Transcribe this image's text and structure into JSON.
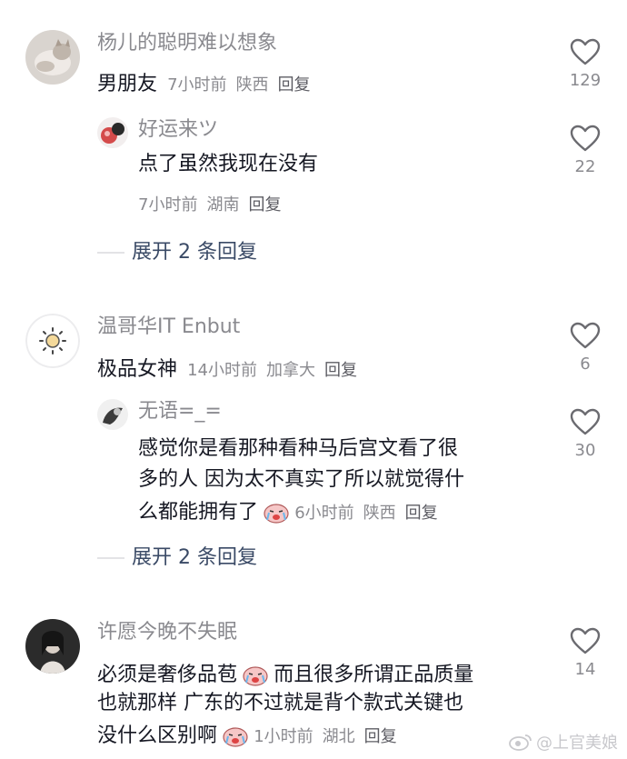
{
  "comments": [
    {
      "username": "杨儿的聪明难以想象",
      "text": "男朋友",
      "time": "7小时前",
      "location": "陕西",
      "reply_label": "回复",
      "likes": "129",
      "replies": [
        {
          "username": "好运来ツ",
          "text_lines": [
            "点了虽然我现在没有"
          ],
          "time": "7小时前",
          "location": "湖南",
          "reply_label": "回复",
          "likes": "22"
        }
      ],
      "expand_label": "展开 2 条回复"
    },
    {
      "username": "温哥华IT Enbut",
      "text": "极品女神",
      "time": "14小时前",
      "location": "加拿大",
      "reply_label": "回复",
      "likes": "6",
      "replies": [
        {
          "username": "无语=_=",
          "text_lines": [
            "感觉你是看那种看种马后宫文看了很",
            "多的人 因为太不真实了所以就觉得什",
            "么都能拥有了"
          ],
          "time": "6小时前",
          "location": "陕西",
          "reply_label": "回复",
          "likes": "30"
        }
      ],
      "expand_label": "展开 2 条回复"
    },
    {
      "username": "许愿今晚不失眠",
      "text_lines": [
        "必须是奢侈品苞",
        "而且很多所谓正品质量",
        "也就那样 广东的不过就是背个款式关键也",
        "没什么区别啊"
      ],
      "time": "1小时前",
      "location": "湖北",
      "reply_label": "回复",
      "likes": "14"
    }
  ],
  "watermark": "@上官美娘",
  "icons": {
    "like": "heart-outline-icon",
    "emoji": "crying-emoji-icon",
    "weibo": "weibo-logo-icon"
  },
  "colors": {
    "username": "#8a8a8f",
    "text": "#161823",
    "expand": "#3a4a66",
    "divider": "#e3e3e6"
  }
}
